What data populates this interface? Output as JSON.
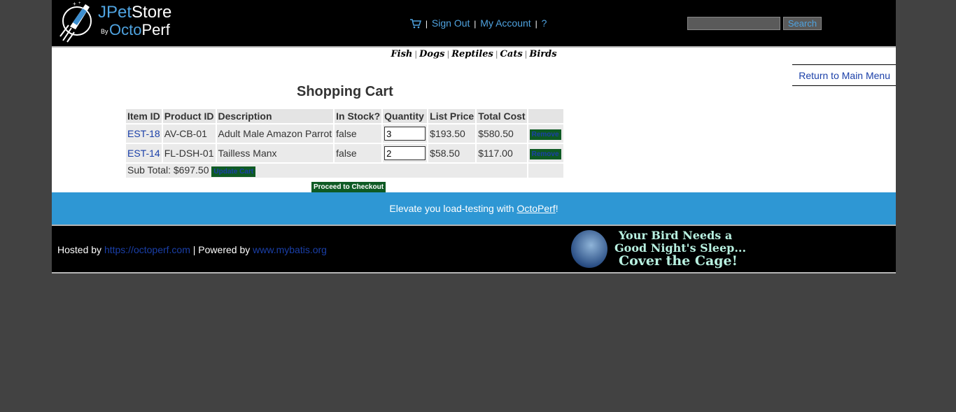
{
  "header": {
    "logo": {
      "part1": "J",
      "part2": "Pet",
      "part3": "Store",
      "by": "By",
      "part4": "Octo",
      "part5": "Perf"
    },
    "menu": {
      "sign_out": "Sign Out",
      "my_account": "My Account",
      "help": "?",
      "sep": "|"
    },
    "search": {
      "button": "Search",
      "value": ""
    }
  },
  "quick_links": [
    "Fish",
    "Dogs",
    "Reptiles",
    "Cats",
    "Birds"
  ],
  "quick_sep": "|",
  "content": {
    "return_link": "Return to Main Menu",
    "title": "Shopping Cart",
    "columns": [
      "Item ID",
      "Product ID",
      "Description",
      "In Stock?",
      "Quantity",
      "List Price",
      "Total Cost",
      ""
    ],
    "rows": [
      {
        "item_id": "EST-18",
        "product_id": "AV-CB-01",
        "description": "Adult Male Amazon Parrot",
        "in_stock": "false",
        "quantity": "3",
        "list_price": "$193.50",
        "total_cost": "$580.50",
        "remove": "Remove"
      },
      {
        "item_id": "EST-14",
        "product_id": "FL-DSH-01",
        "description": "Tailless Manx",
        "in_stock": "false",
        "quantity": "2",
        "list_price": "$58.50",
        "total_cost": "$117.00",
        "remove": "Remove"
      }
    ],
    "subtotal_label": "Sub Total: $697.50",
    "update_cart": "Update Cart",
    "checkout": "Proceed to Checkout"
  },
  "banner": {
    "text": "Elevate you load-testing with ",
    "link": "OctoPerf",
    "end": "!"
  },
  "footer": {
    "hosted_by": "Hosted by ",
    "hosted_link": "https://octoperf.com",
    "powered_by": " | Powered by ",
    "powered_link": "www.mybatis.org",
    "ad_lines": [
      "Your Bird Needs a",
      "Good Night's Sleep...",
      "Cover the Cage!"
    ]
  },
  "colors": {
    "accent": "#2e97d4",
    "button_green": "#0e5a24",
    "link": "#1a3fa8",
    "page_bg": "#424242"
  }
}
